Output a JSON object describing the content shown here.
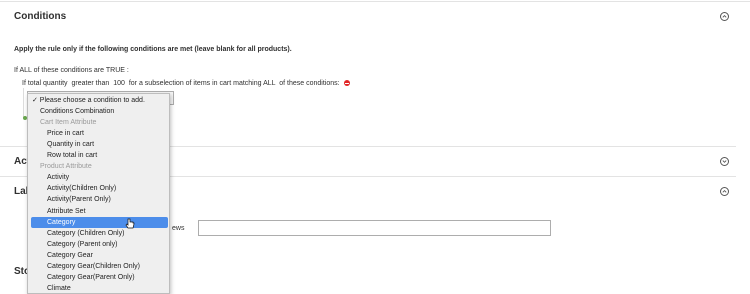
{
  "conditions_section": {
    "title": "Conditions",
    "intro": "Apply the rule only if the following conditions are met (leave blank for all products).",
    "rule_line": {
      "if": "If",
      "aggregator": "ALL",
      "of_these": "of these conditions are",
      "value": "TRUE",
      "colon": ":"
    },
    "sub_rule_line": {
      "if": "If",
      "attribute": "total quantity",
      "operator": "greater than",
      "value": "100",
      "rest": "for a subselection of items in cart matching",
      "aggregator": "ALL",
      "tail": "of these conditions:"
    }
  },
  "actions_section": {
    "title_visible": "Act"
  },
  "labels_section": {
    "title_visible": "Lab",
    "field_label_tail": "ews",
    "field_value": ""
  },
  "storefront_section": {
    "title_visible": "Sto"
  },
  "dropdown": {
    "options": [
      {
        "label": "✓ Please choose a condition to add.",
        "kind": "checked"
      },
      {
        "label": "Conditions Combination",
        "kind": "option"
      },
      {
        "label": "Cart Item Attribute",
        "kind": "group"
      },
      {
        "label": "Price in cart",
        "kind": "option"
      },
      {
        "label": "Quantity in cart",
        "kind": "option"
      },
      {
        "label": "Row total in cart",
        "kind": "option"
      },
      {
        "label": "Product Attribute",
        "kind": "group"
      },
      {
        "label": "Activity",
        "kind": "option"
      },
      {
        "label": "Activity(Children Only)",
        "kind": "option"
      },
      {
        "label": "Activity(Parent Only)",
        "kind": "option"
      },
      {
        "label": "Attribute Set",
        "kind": "option"
      },
      {
        "label": "Category",
        "kind": "selected"
      },
      {
        "label": "Category (Children Only)",
        "kind": "option"
      },
      {
        "label": "Category (Parent only)",
        "kind": "option"
      },
      {
        "label": "Category Gear",
        "kind": "option"
      },
      {
        "label": "Category Gear(Children Only)",
        "kind": "option"
      },
      {
        "label": "Category Gear(Parent Only)",
        "kind": "option"
      },
      {
        "label": "Climate",
        "kind": "option"
      }
    ]
  },
  "colors": {
    "highlight": "#4c8dea",
    "remove_icon": "#e22626",
    "group_text": "#9a9a9a"
  },
  "icons": {
    "collapse": "chevron-up-icon",
    "expand": "chevron-down-icon",
    "remove": "remove-condition-icon",
    "cursor": "pointer-hand-icon"
  }
}
